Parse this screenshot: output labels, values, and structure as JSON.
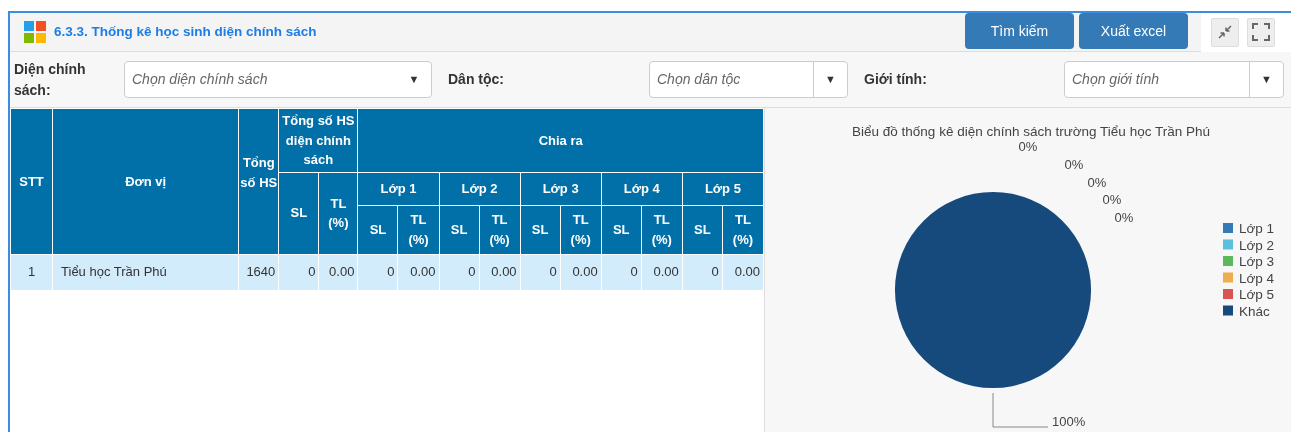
{
  "header": {
    "title": "6.3.3. Thống kê học sinh diện chính sách",
    "buttons": [
      "Tìm kiếm",
      "Xuất excel"
    ]
  },
  "filters": [
    {
      "label": "Diện chính sách:",
      "placeholder": "Chọn diện chính sách",
      "kind": "plain",
      "arrow": "▼"
    },
    {
      "label": "Dân tộc:",
      "placeholder": "Chọn dân tộc",
      "kind": "split",
      "arrow": "▼"
    },
    {
      "label": "Giới tính:",
      "placeholder": "Chọn giới tính",
      "kind": "split",
      "arrow": "▼"
    }
  ],
  "table": {
    "stt": "STT",
    "unit": "Đơn vị",
    "total": "Tổng số HS",
    "policy_total": {
      "label": "Tổng số HS diện chính sách",
      "sub": [
        "SL",
        "TL (%)"
      ]
    },
    "split": {
      "label": "Chia ra",
      "groups": [
        {
          "label": "Lớp 1",
          "sub": [
            "SL",
            "TL (%)"
          ]
        },
        {
          "label": "Lớp 2",
          "sub": [
            "SL",
            "TL (%)"
          ]
        },
        {
          "label": "Lớp 3",
          "sub": [
            "SL",
            "TL (%)"
          ]
        },
        {
          "label": "Lớp 4",
          "sub": [
            "SL",
            "TL (%)"
          ]
        },
        {
          "label": "Lớp 5",
          "sub": [
            "SL",
            "TL (%)"
          ]
        }
      ]
    },
    "rows": [
      {
        "cells": [
          "1",
          "Tiểu học Trần Phú",
          "1640",
          "0",
          "0.00",
          "0",
          "0.00",
          "0",
          "0.00",
          "0",
          "0.00",
          "0",
          "0.00",
          "0",
          "0.00"
        ]
      }
    ]
  },
  "chart": {
    "chart_data": {
      "type": "pie",
      "title": "Biểu đồ thống kê diện chính sách trường Tiểu học Trần Phú",
      "categories": [
        "Lớp 1",
        "Lớp 2",
        "Lớp 3",
        "Lớp 4",
        "Lớp 5",
        "Khác"
      ],
      "values": [
        0,
        0,
        0,
        0,
        0,
        100
      ],
      "colors": [
        "#337ab7",
        "#5bc0de",
        "#5cb85c",
        "#f0ad4e",
        "#d9534f",
        "#174a7c"
      ],
      "value_labels": [
        "0%",
        "0%",
        "0%",
        "0%",
        "0%",
        "100%"
      ]
    }
  }
}
